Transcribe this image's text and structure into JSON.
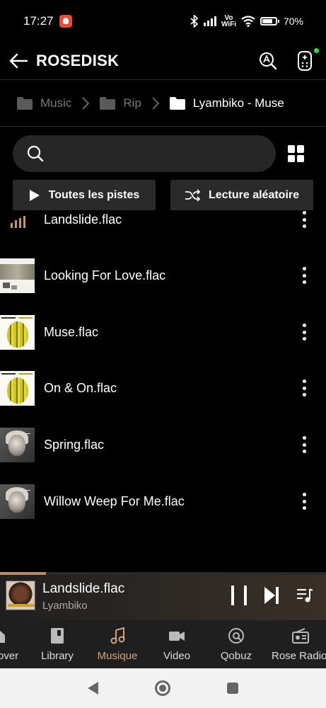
{
  "status_bar": {
    "time": "17:27",
    "network": "Vo\nWiFi",
    "battery": "70%"
  },
  "header": {
    "title": "ROSEDISK"
  },
  "breadcrumb": [
    {
      "label": "Music"
    },
    {
      "label": "Rip"
    },
    {
      "label": "Lyambiko - Muse"
    }
  ],
  "search": {
    "placeholder": ""
  },
  "actions": {
    "all_tracks": "Toutes les pistes",
    "shuffle": "Lecture aléatoire"
  },
  "tracks": [
    {
      "title": "Landslide.flac",
      "playing": true
    },
    {
      "title": "Looking For Love.flac"
    },
    {
      "title": "Muse.flac"
    },
    {
      "title": "On & On.flac"
    },
    {
      "title": "Spring.flac"
    },
    {
      "title": "Willow Weep For Me.flac"
    }
  ],
  "now_playing": {
    "title": "Landslide.flac",
    "artist": "Lyambiko",
    "progress": 0.14
  },
  "bottom_nav": [
    {
      "label": "Discover",
      "icon": "home-icon"
    },
    {
      "label": "Library",
      "icon": "library-icon"
    },
    {
      "label": "Musique",
      "icon": "music-note-icon",
      "active": true
    },
    {
      "label": "Video",
      "icon": "video-icon"
    },
    {
      "label": "Qobuz",
      "icon": "qobuz-icon"
    },
    {
      "label": "Rose Radio",
      "icon": "radio-icon"
    }
  ],
  "colors": {
    "accent": "#d3a27a",
    "background": "#000000",
    "surface": "#262626"
  }
}
